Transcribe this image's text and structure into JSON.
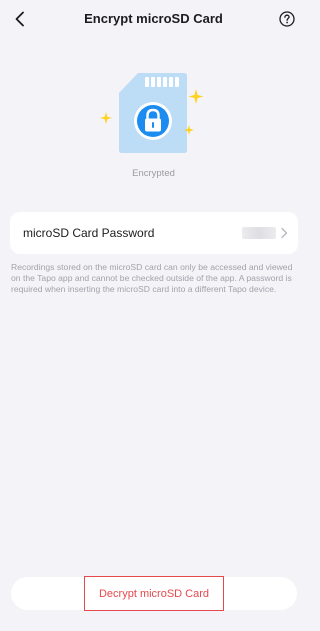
{
  "header": {
    "title": "Encrypt microSD Card",
    "back_icon": "chevron-left-icon",
    "help_icon": "question-circle-icon"
  },
  "hero": {
    "icon": "encrypted-sd-card-icon",
    "status": "Encrypted"
  },
  "password_row": {
    "label": "microSD Card Password",
    "chevron_icon": "chevron-right-icon"
  },
  "description": "Recordings stored on the microSD card can only be accessed and viewed on the Tapo app and cannot be checked outside of the app. A password is required when inserting the microSD card into a different Tapo device.",
  "footer": {
    "decrypt_label": "Decrypt microSD Card"
  },
  "colors": {
    "background": "#f3f3f8",
    "accent": "#1c8cf0",
    "card_blue": "#bddcf5",
    "sparkle": "#ffd21f",
    "danger": "#e5484d",
    "secondary_text": "#a2a2aa"
  }
}
